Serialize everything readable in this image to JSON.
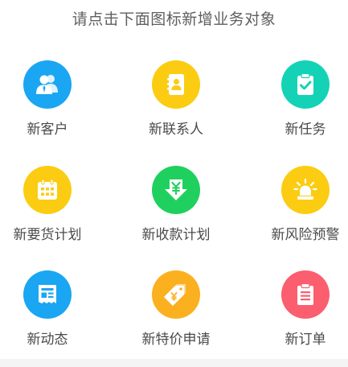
{
  "header": {
    "title": "请点击下面图标新增业务对象"
  },
  "colors": {
    "blue": "#1aa6f2",
    "yellow": "#fbcc12",
    "teal": "#14d2b6",
    "green": "#20d05f",
    "orange": "#fbb020",
    "red": "#fb5e6e",
    "title_text": "#5f5f5f",
    "label_text": "#4a4a4a"
  },
  "tiles": [
    {
      "label": "新客户",
      "icon": "customer-icon",
      "color": "#1aa6f2"
    },
    {
      "label": "新联系人",
      "icon": "contact-book-icon",
      "color": "#fbcc12"
    },
    {
      "label": "新任务",
      "icon": "task-clipboard-icon",
      "color": "#14d2b6"
    },
    {
      "label": "新要货计划",
      "icon": "calendar-icon",
      "color": "#fbcc12"
    },
    {
      "label": "新收款计划",
      "icon": "yuan-collect-icon",
      "color": "#20d05f"
    },
    {
      "label": "新风险预警",
      "icon": "alarm-light-icon",
      "color": "#fbcc12"
    },
    {
      "label": "新动态",
      "icon": "news-icon",
      "color": "#1aa6f2"
    },
    {
      "label": "新特价申请",
      "icon": "price-tag-icon",
      "color": "#fbb020"
    },
    {
      "label": "新订单",
      "icon": "order-clipboard-icon",
      "color": "#fb5e6e"
    }
  ]
}
